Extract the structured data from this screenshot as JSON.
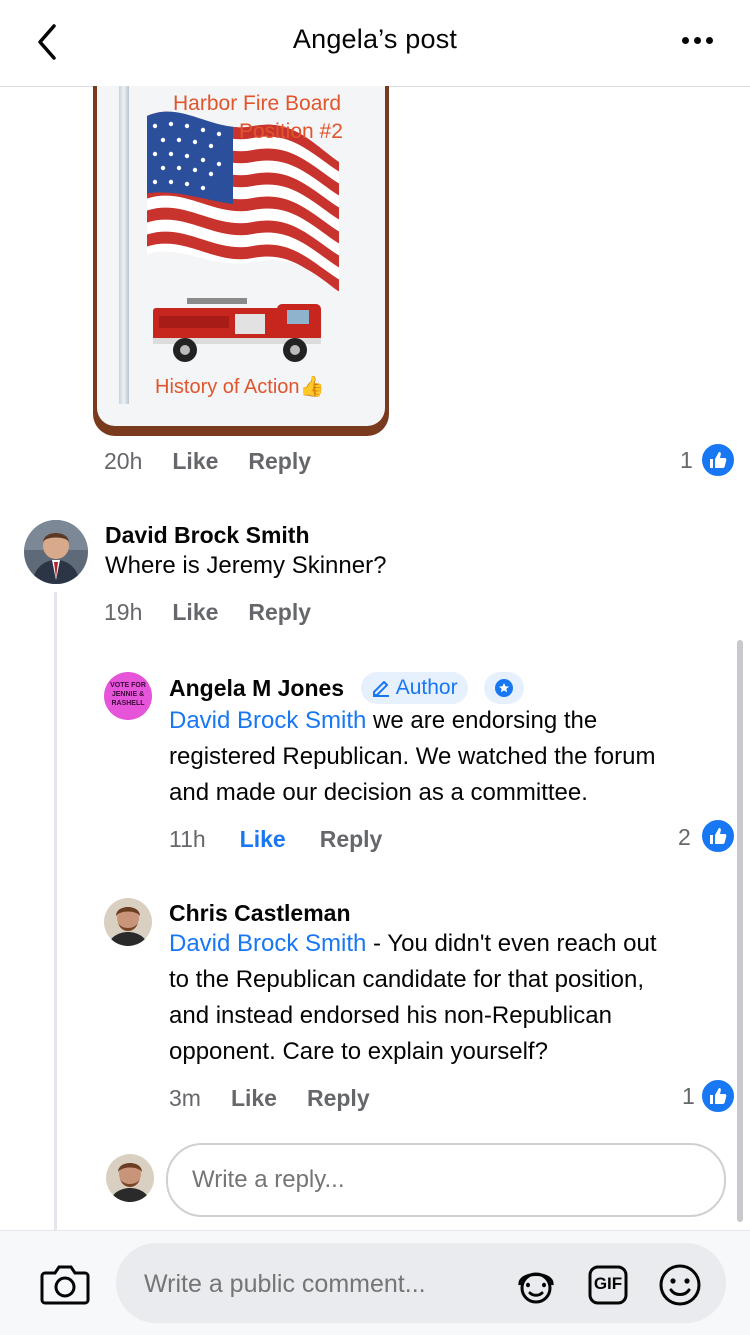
{
  "header": {
    "title": "Angela’s post",
    "back_icon": "chevron-left-icon",
    "more_icon": "more-dots-icon"
  },
  "post_image": {
    "line1": "Harbor Fire Board",
    "line2": "Position #2",
    "footer": "History of Action👍"
  },
  "comment_top": {
    "time": "20h",
    "like": "Like",
    "reply": "Reply",
    "like_count": "1"
  },
  "comment_david": {
    "name": "David Brock Smith",
    "text": "Where is Jeremy Skinner?",
    "time": "19h",
    "like": "Like",
    "reply": "Reply"
  },
  "reply_angela": {
    "avatar_text": "VOTE FOR JENNIE & RASHELL",
    "name": "Angela M Jones",
    "author_label": "Author",
    "mention": "David Brock Smith",
    "text_line1": " we are endorsing the",
    "text_line2": "registered Republican. We watched the forum",
    "text_line3": "and made our decision as a committee.",
    "time": "11h",
    "like": "Like",
    "reply": "Reply",
    "like_count": "2"
  },
  "reply_chris": {
    "name": "Chris Castleman",
    "mention": "David Brock Smith",
    "text_line1": " - You didn't even reach out",
    "text_line2": "to the Republican candidate for that position,",
    "text_line3": "and instead endorsed his non-Republican",
    "text_line4": "opponent. Care to explain yourself?",
    "time": "3m",
    "like": "Like",
    "reply": "Reply",
    "like_count": "1"
  },
  "reply_input": {
    "placeholder": "Write a reply..."
  },
  "bottom": {
    "placeholder": "Write a public comment...",
    "gif_label": "GIF"
  },
  "colors": {
    "accent": "#1877f2",
    "secondary_text": "#65676b"
  }
}
